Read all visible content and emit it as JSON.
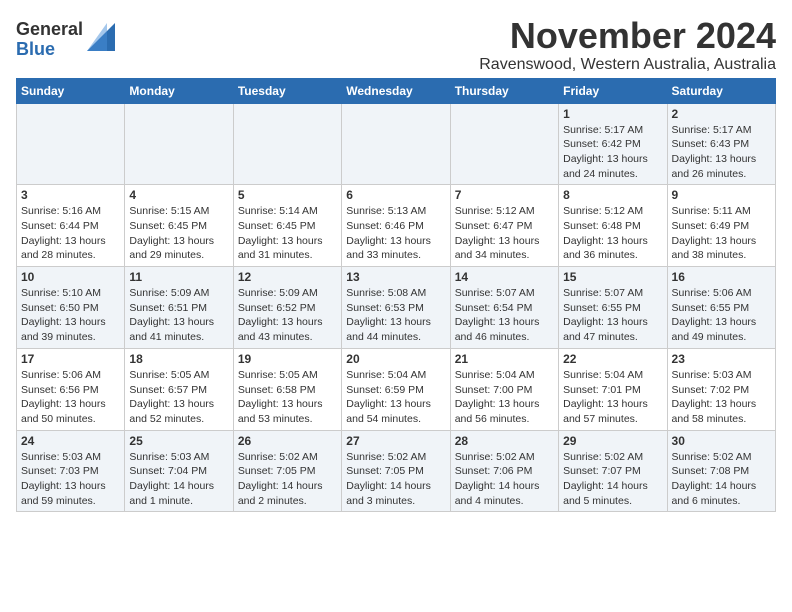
{
  "logo": {
    "line1": "General",
    "line2": "Blue"
  },
  "title": "November 2024",
  "subtitle": "Ravenswood, Western Australia, Australia",
  "days_of_week": [
    "Sunday",
    "Monday",
    "Tuesday",
    "Wednesday",
    "Thursday",
    "Friday",
    "Saturday"
  ],
  "weeks": [
    [
      {
        "day": "",
        "detail": ""
      },
      {
        "day": "",
        "detail": ""
      },
      {
        "day": "",
        "detail": ""
      },
      {
        "day": "",
        "detail": ""
      },
      {
        "day": "",
        "detail": ""
      },
      {
        "day": "1",
        "detail": "Sunrise: 5:17 AM\nSunset: 6:42 PM\nDaylight: 13 hours\nand 24 minutes."
      },
      {
        "day": "2",
        "detail": "Sunrise: 5:17 AM\nSunset: 6:43 PM\nDaylight: 13 hours\nand 26 minutes."
      }
    ],
    [
      {
        "day": "3",
        "detail": "Sunrise: 5:16 AM\nSunset: 6:44 PM\nDaylight: 13 hours\nand 28 minutes."
      },
      {
        "day": "4",
        "detail": "Sunrise: 5:15 AM\nSunset: 6:45 PM\nDaylight: 13 hours\nand 29 minutes."
      },
      {
        "day": "5",
        "detail": "Sunrise: 5:14 AM\nSunset: 6:45 PM\nDaylight: 13 hours\nand 31 minutes."
      },
      {
        "day": "6",
        "detail": "Sunrise: 5:13 AM\nSunset: 6:46 PM\nDaylight: 13 hours\nand 33 minutes."
      },
      {
        "day": "7",
        "detail": "Sunrise: 5:12 AM\nSunset: 6:47 PM\nDaylight: 13 hours\nand 34 minutes."
      },
      {
        "day": "8",
        "detail": "Sunrise: 5:12 AM\nSunset: 6:48 PM\nDaylight: 13 hours\nand 36 minutes."
      },
      {
        "day": "9",
        "detail": "Sunrise: 5:11 AM\nSunset: 6:49 PM\nDaylight: 13 hours\nand 38 minutes."
      }
    ],
    [
      {
        "day": "10",
        "detail": "Sunrise: 5:10 AM\nSunset: 6:50 PM\nDaylight: 13 hours\nand 39 minutes."
      },
      {
        "day": "11",
        "detail": "Sunrise: 5:09 AM\nSunset: 6:51 PM\nDaylight: 13 hours\nand 41 minutes."
      },
      {
        "day": "12",
        "detail": "Sunrise: 5:09 AM\nSunset: 6:52 PM\nDaylight: 13 hours\nand 43 minutes."
      },
      {
        "day": "13",
        "detail": "Sunrise: 5:08 AM\nSunset: 6:53 PM\nDaylight: 13 hours\nand 44 minutes."
      },
      {
        "day": "14",
        "detail": "Sunrise: 5:07 AM\nSunset: 6:54 PM\nDaylight: 13 hours\nand 46 minutes."
      },
      {
        "day": "15",
        "detail": "Sunrise: 5:07 AM\nSunset: 6:55 PM\nDaylight: 13 hours\nand 47 minutes."
      },
      {
        "day": "16",
        "detail": "Sunrise: 5:06 AM\nSunset: 6:55 PM\nDaylight: 13 hours\nand 49 minutes."
      }
    ],
    [
      {
        "day": "17",
        "detail": "Sunrise: 5:06 AM\nSunset: 6:56 PM\nDaylight: 13 hours\nand 50 minutes."
      },
      {
        "day": "18",
        "detail": "Sunrise: 5:05 AM\nSunset: 6:57 PM\nDaylight: 13 hours\nand 52 minutes."
      },
      {
        "day": "19",
        "detail": "Sunrise: 5:05 AM\nSunset: 6:58 PM\nDaylight: 13 hours\nand 53 minutes."
      },
      {
        "day": "20",
        "detail": "Sunrise: 5:04 AM\nSunset: 6:59 PM\nDaylight: 13 hours\nand 54 minutes."
      },
      {
        "day": "21",
        "detail": "Sunrise: 5:04 AM\nSunset: 7:00 PM\nDaylight: 13 hours\nand 56 minutes."
      },
      {
        "day": "22",
        "detail": "Sunrise: 5:04 AM\nSunset: 7:01 PM\nDaylight: 13 hours\nand 57 minutes."
      },
      {
        "day": "23",
        "detail": "Sunrise: 5:03 AM\nSunset: 7:02 PM\nDaylight: 13 hours\nand 58 minutes."
      }
    ],
    [
      {
        "day": "24",
        "detail": "Sunrise: 5:03 AM\nSunset: 7:03 PM\nDaylight: 13 hours\nand 59 minutes."
      },
      {
        "day": "25",
        "detail": "Sunrise: 5:03 AM\nSunset: 7:04 PM\nDaylight: 14 hours\nand 1 minute."
      },
      {
        "day": "26",
        "detail": "Sunrise: 5:02 AM\nSunset: 7:05 PM\nDaylight: 14 hours\nand 2 minutes."
      },
      {
        "day": "27",
        "detail": "Sunrise: 5:02 AM\nSunset: 7:05 PM\nDaylight: 14 hours\nand 3 minutes."
      },
      {
        "day": "28",
        "detail": "Sunrise: 5:02 AM\nSunset: 7:06 PM\nDaylight: 14 hours\nand 4 minutes."
      },
      {
        "day": "29",
        "detail": "Sunrise: 5:02 AM\nSunset: 7:07 PM\nDaylight: 14 hours\nand 5 minutes."
      },
      {
        "day": "30",
        "detail": "Sunrise: 5:02 AM\nSunset: 7:08 PM\nDaylight: 14 hours\nand 6 minutes."
      }
    ]
  ]
}
